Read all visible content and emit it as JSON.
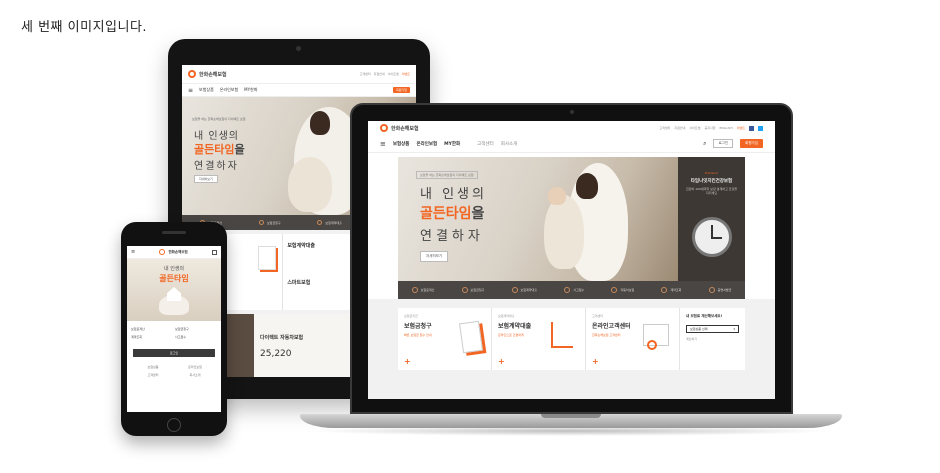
{
  "caption": "세 번째 이미지입니다.",
  "brand": {
    "name": "한화손해보험",
    "accent_color": "#f26522",
    "dark_strip_color": "#4a4643"
  },
  "utility_nav": {
    "links": [
      "고객센터",
      "지점안내",
      "사이트맵",
      "공지사항",
      "ENGLISH"
    ],
    "highlight": "이벤트"
  },
  "main_nav": {
    "items": [
      "보험상품",
      "온라인보험",
      "MY한화"
    ],
    "sub_items": [
      "고객센터",
      "회사소개"
    ],
    "search_icon": "search-icon",
    "login_label": "로그인",
    "join_label": "회원가입"
  },
  "hero": {
    "tagline": "보험을 하는 한화손해보험의 다이렉트 보험",
    "line1": "내 인생의",
    "line2_highlight": "골든타임",
    "line2_suffix": "을",
    "line3": "연결하자",
    "cta": "자세히보기"
  },
  "side_banner": {
    "label": "Premium",
    "title": "타임나잇지킨건강보험",
    "desc": "진단비 100세까지 보장 설계하고 건강을 지키세요"
  },
  "quick_menu": {
    "items": [
      "보험료계산",
      "보험금청구",
      "보험계약대출",
      "사고접수",
      "자동차보험",
      "계약조회",
      "증명서발급"
    ]
  },
  "cards": [
    {
      "tag": "보험금지급",
      "title": "보험금청구",
      "desc": "빠른 보험금 접수 안내"
    },
    {
      "tag": "보험계약대출",
      "title": "보험계약대출",
      "desc": "온라인으로 간편하게"
    },
    {
      "tag": "고객센터",
      "title": "온라인고객센터",
      "desc": "한화손해보험 고객센터"
    }
  ],
  "calculator": {
    "title": "내 보험료 계산해보세요!",
    "select_label": "보험상품 선택",
    "button": "계산하기"
  },
  "tablet": {
    "card_titles": [
      "보험계약대출",
      "스마트보험"
    ],
    "promo_title": "다이렉트 자동차보험",
    "promo_price": "25,220"
  },
  "phone": {
    "hero_line1": "내 인생의",
    "hero_line2": "골든타임",
    "grid_items": [
      "보험료계산",
      "보험금청구",
      "계약조회",
      "사고접수"
    ],
    "button": "로그인"
  }
}
